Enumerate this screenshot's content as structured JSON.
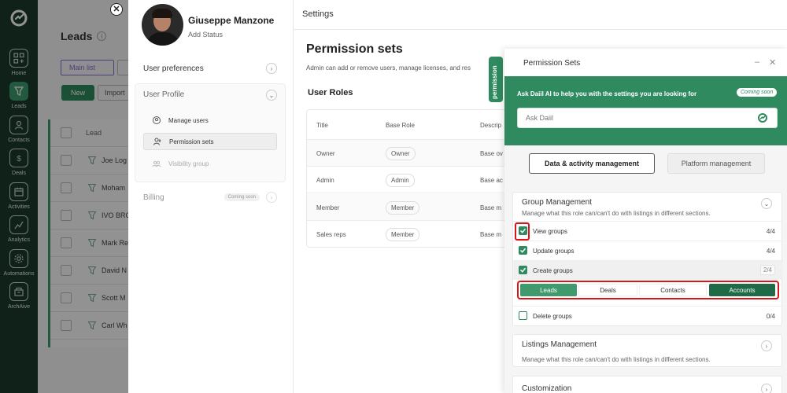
{
  "sidebar": {
    "items": [
      {
        "label": "Home",
        "icon": "home-grid-icon"
      },
      {
        "label": "Leads",
        "icon": "leads-funnel-icon",
        "active": true
      },
      {
        "label": "Contacts",
        "icon": "contacts-icon"
      },
      {
        "label": "Deals",
        "icon": "deals-dollar-icon"
      },
      {
        "label": "Activities",
        "icon": "activities-calendar-icon"
      },
      {
        "label": "Analytics",
        "icon": "analytics-chart-icon"
      },
      {
        "label": "Automations",
        "icon": "automations-gear-icon"
      },
      {
        "label": "ArchAive",
        "icon": "archive-icon"
      }
    ]
  },
  "leads_bg": {
    "title": "Leads",
    "list_selector": "Main list",
    "new_label": "New",
    "import_label": "Import",
    "column_header": "Lead",
    "rows": [
      "Joe Log",
      "Moham",
      "IVO BRO",
      "Mark Re",
      "David N",
      "Scott M",
      "Carl Wh"
    ]
  },
  "close_symbol": "✕",
  "profile": {
    "name": "Giuseppe Manzone",
    "status": "Add Status"
  },
  "menu": {
    "user_preferences": "User preferences",
    "user_profile": "User Profile",
    "manage_users": "Manage users",
    "permission_sets": "Permission sets",
    "visibility_group": "Visibility group",
    "billing": "Billing",
    "coming_soon": "Coming soon"
  },
  "settings": {
    "header": "Settings",
    "title": "Permission sets",
    "description": "Admin can add or remove users, manage licenses, and res",
    "side_tab": "permission",
    "user_roles": "User Roles",
    "table": {
      "headers": [
        "Title",
        "Base Role",
        "Descrip"
      ],
      "rows": [
        {
          "title": "Owner",
          "base": "Owner",
          "desc": "Base ov"
        },
        {
          "title": "Admin",
          "base": "Admin",
          "desc": "Base ac"
        },
        {
          "title": "Member",
          "base": "Member",
          "desc": "Base m"
        },
        {
          "title": "Sales reps",
          "base": "Member",
          "desc": "Base m"
        }
      ]
    }
  },
  "modal": {
    "title": "Permission Sets",
    "minimize": "–",
    "close": "✕",
    "ai_prompt": "Ask Daiil AI to help you with the settings you are looking for",
    "ai_badge": "Coming soon",
    "ai_placeholder": "Ask Daiil",
    "tab_active": "Data & activity management",
    "tab_inactive": "Platform management",
    "group_management": {
      "title": "Group Management",
      "description": "Manage what this role can/can't do with listings in different sections.",
      "rows": [
        {
          "label": "View groups",
          "count": "4/4",
          "checked": true
        },
        {
          "label": "Update groups",
          "count": "4/4",
          "checked": true
        },
        {
          "label": "Create groups",
          "count": "2/4",
          "checked": true
        },
        {
          "label": "Delete groups",
          "count": "0/4",
          "checked": false
        }
      ],
      "chips": [
        {
          "label": "Leads",
          "selected": true
        },
        {
          "label": "Deals",
          "selected": false
        },
        {
          "label": "Contacts",
          "selected": false
        },
        {
          "label": "Accounts",
          "selected": true
        }
      ]
    },
    "listings_management": {
      "title": "Listings Management",
      "description": "Manage what this role can/can't do with listings in different sections."
    },
    "customization": {
      "title": "Customization"
    }
  },
  "colors": {
    "sidebar": "#1d3a2b",
    "accent": "#2f8a5f",
    "highlight": "#d8161a"
  }
}
